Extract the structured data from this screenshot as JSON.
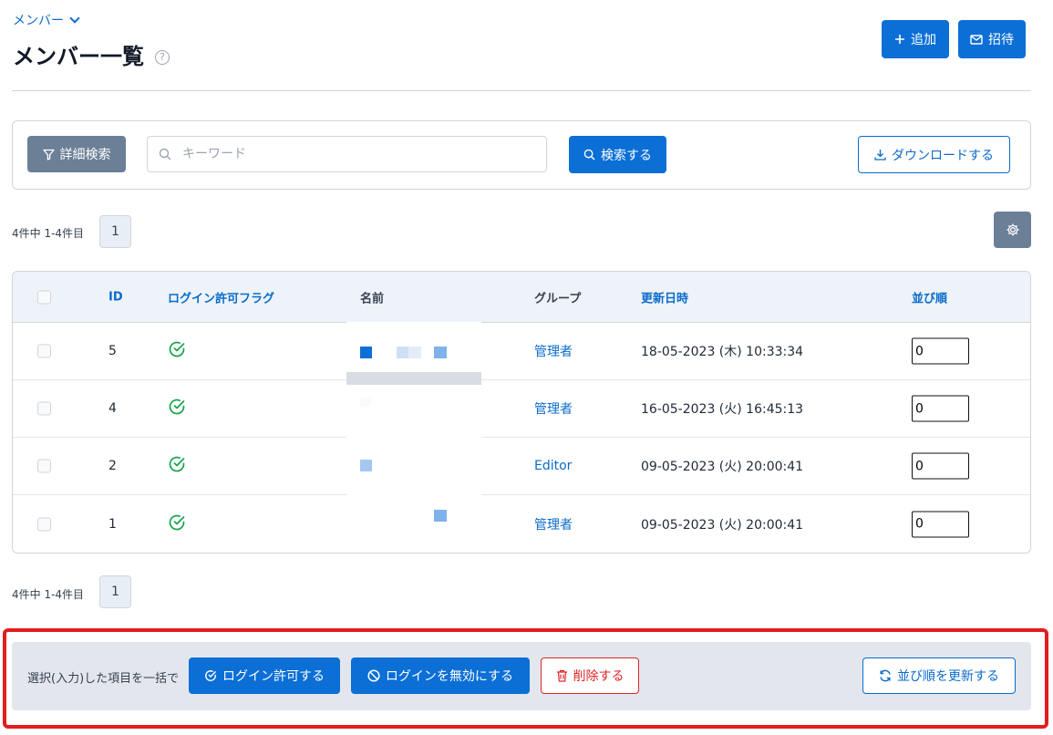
{
  "breadcrumb": {
    "label": "メンバー"
  },
  "page": {
    "title": "メンバー一覧",
    "help": "?"
  },
  "header_actions": {
    "add_label": "追加",
    "invite_label": "招待"
  },
  "search": {
    "advanced_label": "詳細検索",
    "placeholder": "キーワード",
    "value": "",
    "search_label": "検索する",
    "download_label": "ダウンロードする"
  },
  "pagination_top": {
    "summary": "4件中 1-4件目",
    "page": "1"
  },
  "pagination_bottom": {
    "summary": "4件中 1-4件目",
    "page": "1"
  },
  "table": {
    "columns": {
      "id": "ID",
      "login_flag": "ログイン許可フラグ",
      "name": "名前",
      "group": "グループ",
      "updated": "更新日時",
      "order": "並び順"
    },
    "rows": [
      {
        "id": "5",
        "login_allowed": true,
        "name": "",
        "group": "管理者",
        "updated": "18-05-2023 (木) 10:33:34",
        "order": "0"
      },
      {
        "id": "4",
        "login_allowed": true,
        "name": "",
        "group": "管理者",
        "updated": "16-05-2023 (火) 16:45:13",
        "order": "0"
      },
      {
        "id": "2",
        "login_allowed": true,
        "name": "",
        "group": "Editor",
        "updated": "09-05-2023 (火) 20:00:41",
        "order": "0"
      },
      {
        "id": "1",
        "login_allowed": true,
        "name": "",
        "group": "管理者",
        "updated": "09-05-2023 (火) 20:00:41",
        "order": "0"
      }
    ]
  },
  "bulk": {
    "label": "選択(入力)した項目を一括で",
    "allow_login": "ログイン許可する",
    "disable_login": "ログインを無効にする",
    "delete": "削除する",
    "update_order": "並び順を更新する"
  },
  "colors": {
    "primary": "#0b6fd6",
    "danger": "#dc2626",
    "success": "#16a34a",
    "highlight_border": "#e11d1d"
  }
}
